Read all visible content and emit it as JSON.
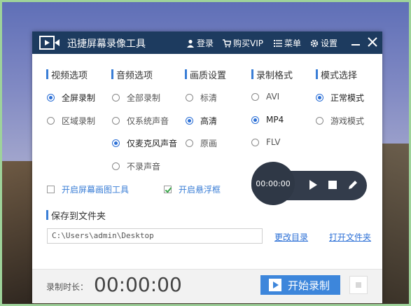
{
  "window": {
    "title": "迅捷屏幕录像工具",
    "menu": {
      "login": "登录",
      "vip": "购买VIP",
      "menu": "菜单",
      "settings": "设置"
    }
  },
  "sections": {
    "video": {
      "title": "视频选项",
      "options": [
        "全屏录制",
        "区域录制"
      ],
      "selected": "全屏录制"
    },
    "audio": {
      "title": "音频选项",
      "options": [
        "全部录制",
        "仅系统声音",
        "仅麦克风声音",
        "不录声音"
      ],
      "selected": "仅麦克风声音"
    },
    "quality": {
      "title": "画质设置",
      "options": [
        "标清",
        "高清",
        "原画"
      ],
      "selected": "高清"
    },
    "format": {
      "title": "录制格式",
      "options": [
        "AVI",
        "MP4",
        "FLV"
      ],
      "selected": "MP4"
    },
    "mode": {
      "title": "模式选择",
      "options": [
        "正常模式",
        "游戏模式"
      ],
      "selected": "正常模式"
    }
  },
  "checkboxes": {
    "draw_tool": {
      "label": "开启屏幕画图工具",
      "checked": false
    },
    "float_bar": {
      "label": "开启悬浮框",
      "checked": true
    }
  },
  "floating": {
    "time": "00:00:00"
  },
  "save": {
    "title": "保存到文件夹",
    "path": "C:\\Users\\admin\\Desktop",
    "change_dir": "更改目录",
    "open_folder": "打开文件夹"
  },
  "bottom": {
    "duration_label": "录制时长：",
    "duration_value": "00:00:00",
    "start_label": "开始录制"
  },
  "colors": {
    "titlebar": "#1d3b5f",
    "accent": "#3d86db",
    "radio_selected": "#2b6fd6",
    "checkbox_tick": "#3aa74a"
  }
}
